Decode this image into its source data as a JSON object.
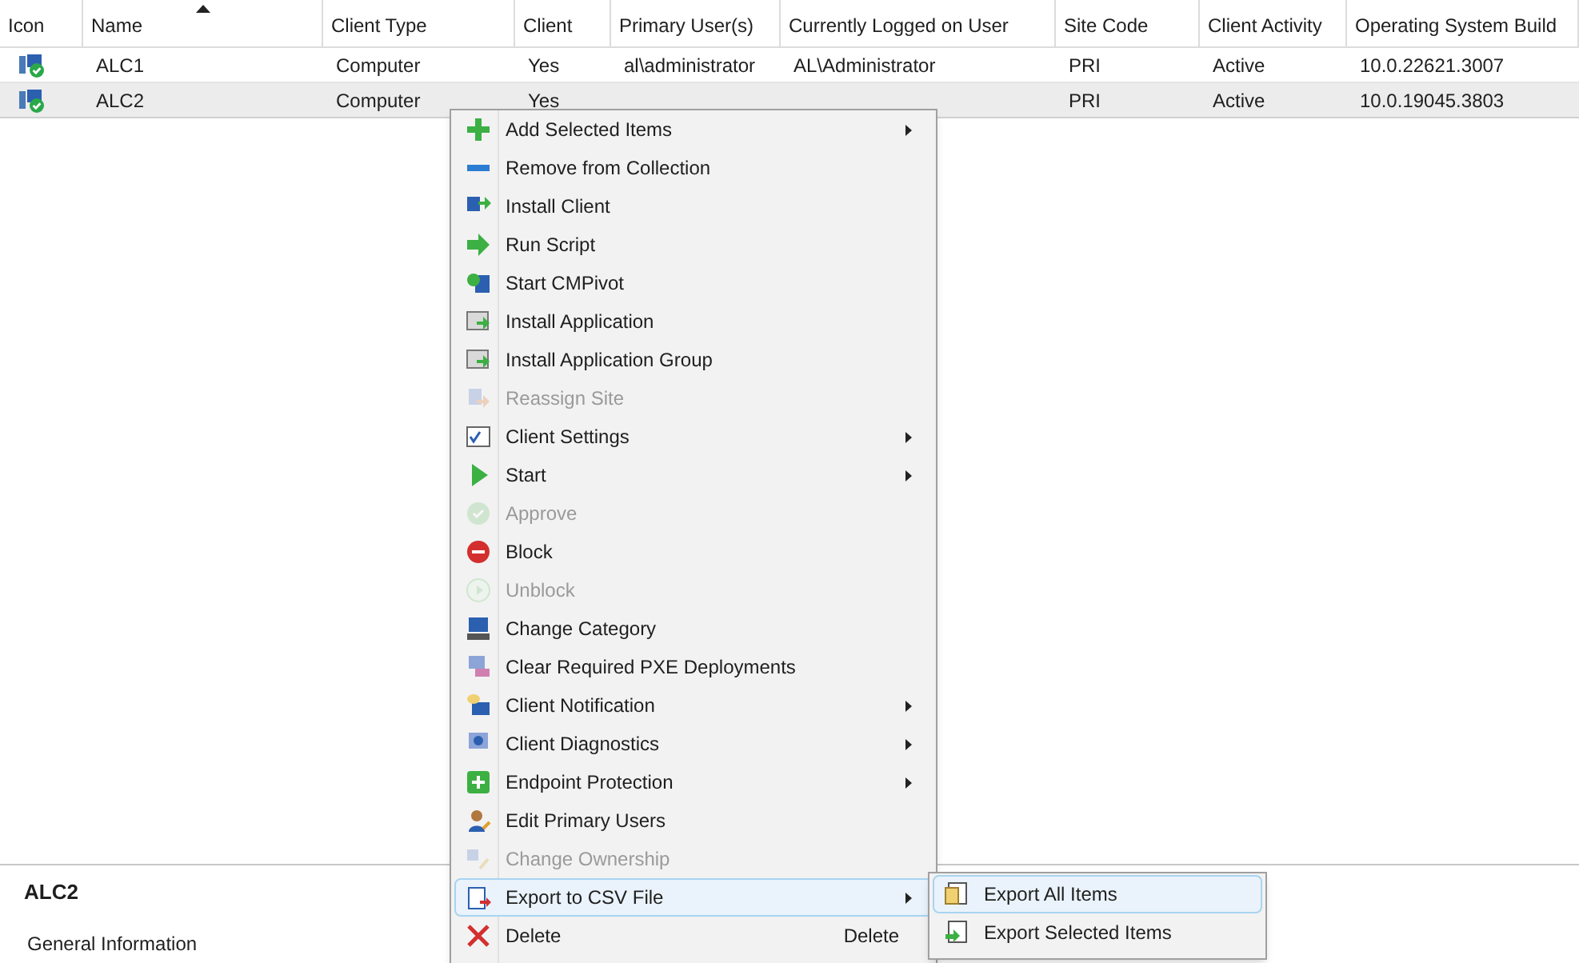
{
  "table": {
    "columns": [
      {
        "label": "Icon",
        "sorted": false
      },
      {
        "label": "Name",
        "sorted": true
      },
      {
        "label": "Client Type",
        "sorted": false
      },
      {
        "label": "Client",
        "sorted": false
      },
      {
        "label": "Primary User(s)",
        "sorted": false
      },
      {
        "label": "Currently Logged on User",
        "sorted": false
      },
      {
        "label": "Site Code",
        "sorted": false
      },
      {
        "label": "Client Activity",
        "sorted": false
      },
      {
        "label": "Operating System Build",
        "sorted": false
      }
    ],
    "rows": [
      {
        "selected": false,
        "cells": [
          "",
          "ALC1",
          "Computer",
          "Yes",
          "al\\administrator",
          "AL\\Administrator",
          "PRI",
          "Active",
          "10.0.22621.3007"
        ]
      },
      {
        "selected": true,
        "cells": [
          "",
          "ALC2",
          "Computer",
          "Yes",
          "",
          "",
          "PRI",
          "Active",
          "10.0.19045.3803"
        ]
      }
    ]
  },
  "details": {
    "title": "ALC2",
    "section": "General Information"
  },
  "context_menu": [
    {
      "label": "Add Selected Items",
      "disabled": false,
      "submenu": true,
      "selected": false
    },
    {
      "label": "Remove from Collection",
      "disabled": false,
      "submenu": false,
      "selected": false
    },
    {
      "label": "Install Client",
      "disabled": false,
      "submenu": false,
      "selected": false
    },
    {
      "label": "Run Script",
      "disabled": false,
      "submenu": false,
      "selected": false
    },
    {
      "label": "Start CMPivot",
      "disabled": false,
      "submenu": false,
      "selected": false
    },
    {
      "label": "Install Application",
      "disabled": false,
      "submenu": false,
      "selected": false
    },
    {
      "label": "Install Application Group",
      "disabled": false,
      "submenu": false,
      "selected": false
    },
    {
      "label": "Reassign Site",
      "disabled": true,
      "submenu": false,
      "selected": false
    },
    {
      "label": "Client Settings",
      "disabled": false,
      "submenu": true,
      "selected": false
    },
    {
      "label": "Start",
      "disabled": false,
      "submenu": true,
      "selected": false
    },
    {
      "label": "Approve",
      "disabled": true,
      "submenu": false,
      "selected": false
    },
    {
      "label": "Block",
      "disabled": false,
      "submenu": false,
      "selected": false
    },
    {
      "label": "Unblock",
      "disabled": true,
      "submenu": false,
      "selected": false
    },
    {
      "label": "Change Category",
      "disabled": false,
      "submenu": false,
      "selected": false
    },
    {
      "label": "Clear Required PXE Deployments",
      "disabled": false,
      "submenu": false,
      "selected": false
    },
    {
      "label": "Client Notification",
      "disabled": false,
      "submenu": true,
      "selected": false
    },
    {
      "label": "Client Diagnostics",
      "disabled": false,
      "submenu": true,
      "selected": false
    },
    {
      "label": "Endpoint Protection",
      "disabled": false,
      "submenu": true,
      "selected": false
    },
    {
      "label": "Edit Primary Users",
      "disabled": false,
      "submenu": false,
      "selected": false
    },
    {
      "label": "Change Ownership",
      "disabled": true,
      "submenu": false,
      "selected": false
    },
    {
      "label": "Export to CSV File",
      "disabled": false,
      "submenu": true,
      "selected": true
    },
    {
      "label": "Delete",
      "disabled": false,
      "submenu": false,
      "selected": false,
      "shortcut": "Delete"
    }
  ],
  "submenu": [
    {
      "label": "Export All Items",
      "selected": true
    },
    {
      "label": "Export Selected Items",
      "selected": false
    }
  ]
}
